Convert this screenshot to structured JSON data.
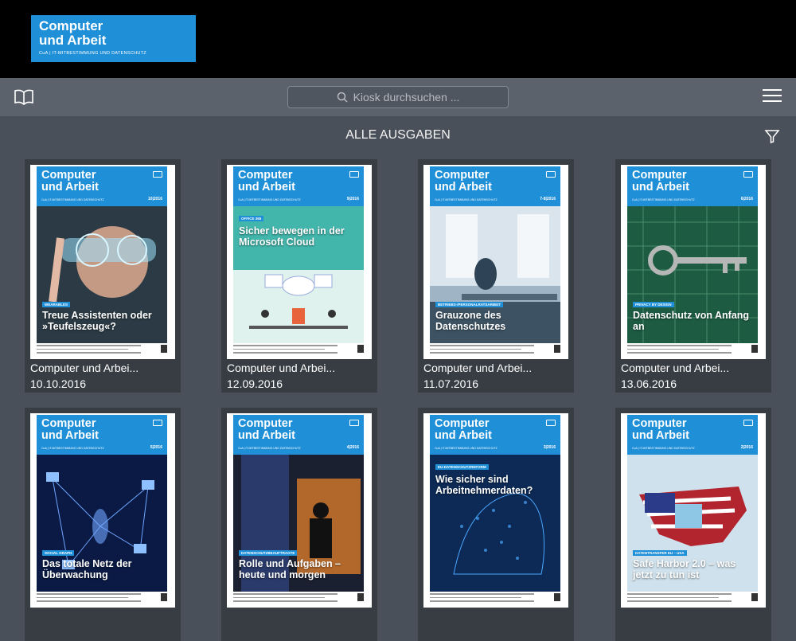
{
  "logo": {
    "line1": "Computer",
    "line2": "und Arbeit",
    "tagline": "CuA | IT-MITBESTIMMUNG UND DATENSCHUTZ"
  },
  "search": {
    "placeholder": "Kiosk durchsuchen ..."
  },
  "heading": "ALLE AUSGABEN",
  "colors": {
    "header": "#000000",
    "toolbar": "#5b626b",
    "background": "#4a5059",
    "accent": "#1f8fd8"
  },
  "icons": {
    "library": "book-icon",
    "search": "search-icon",
    "menu": "menu-icon",
    "filter": "filter-icon"
  },
  "cover_brand": {
    "line1": "Computer",
    "line2": "und Arbeit",
    "subline": "CuA | IT-MITBESTIMMUNG UND DATENSCHUTZ"
  },
  "issues": [
    {
      "title": "Computer und Arbei...",
      "date": "10.10.2016",
      "issue": "10|2016",
      "tag": "WEARABLES",
      "headline": "Treue Assistenten oder »Teufelszeug«?",
      "theme": "face"
    },
    {
      "title": "Computer und Arbei...",
      "date": "12.09.2016",
      "issue": "9|2016",
      "tag": "OFFICE 365",
      "headline": "Sicher bewegen in der Microsoft Cloud",
      "theme": "cloud"
    },
    {
      "title": "Computer und Arbei...",
      "date": "11.07.2016",
      "issue": "7-8|2016",
      "tag": "BETRIEBS-/PERSONALRATSARBEIT",
      "headline": "Grauzone des Datenschutzes",
      "theme": "office"
    },
    {
      "title": "Computer und Arbei...",
      "date": "13.06.2016",
      "issue": "6|2016",
      "tag": "PRIVACY BY DESIGN",
      "headline": "Datenschutz von Anfang an",
      "theme": "key"
    },
    {
      "title": "",
      "date": "",
      "issue": "5|2016",
      "tag": "SOCIAL GRAPH",
      "headline": "Das totale Netz der Überwachung",
      "theme": "network"
    },
    {
      "title": "",
      "date": "",
      "issue": "4|2016",
      "tag": "DATENSCHUTZBEAUFTRAGTE",
      "headline": "Rolle und Aufgaben – heute und morgen",
      "theme": "server"
    },
    {
      "title": "",
      "date": "",
      "issue": "3|2016",
      "tag": "EU-DATENSCHUTZREFORM",
      "headline": "Wie sicher sind Arbeitnehmerdaten?",
      "theme": "europe"
    },
    {
      "title": "",
      "date": "",
      "issue": "2|2016",
      "tag": "DATENTRANSFER EU – USA",
      "headline": "Safe Harbor 2.0 – was jetzt zu tun ist",
      "theme": "usa"
    }
  ]
}
